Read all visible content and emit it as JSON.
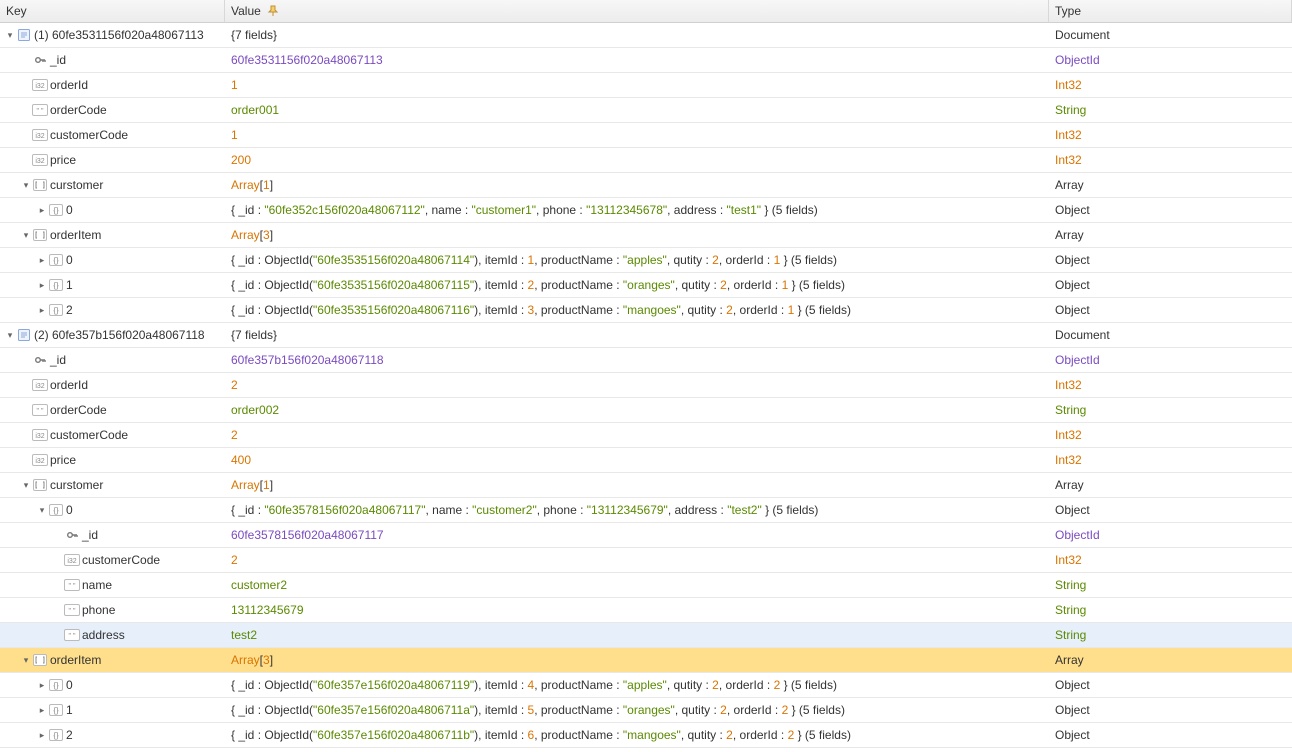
{
  "header": {
    "key": "Key",
    "value": "Value",
    "type": "Type"
  },
  "rows": [
    {
      "depth": 0,
      "tw": "down",
      "icon": "doc",
      "key": "(1) 60fe3531156f020a48067113",
      "value": [
        [
          "plain",
          "{7 fields}"
        ]
      ],
      "type": "Document",
      "typeColor": "plain"
    },
    {
      "depth": 1,
      "tw": "",
      "icon": "keyi",
      "key": "_id",
      "value": [
        [
          "oid",
          "60fe3531156f020a48067113"
        ]
      ],
      "type": "ObjectId",
      "typeColor": "oid"
    },
    {
      "depth": 1,
      "tw": "",
      "icon": "i32",
      "key": "orderId",
      "value": [
        [
          "num",
          "1"
        ]
      ],
      "type": "Int32",
      "typeColor": "num"
    },
    {
      "depth": 1,
      "tw": "",
      "icon": "strb",
      "key": "orderCode",
      "value": [
        [
          "str",
          "order001"
        ]
      ],
      "type": "String",
      "typeColor": "str"
    },
    {
      "depth": 1,
      "tw": "",
      "icon": "i32",
      "key": "customerCode",
      "value": [
        [
          "num",
          "1"
        ]
      ],
      "type": "Int32",
      "typeColor": "num"
    },
    {
      "depth": 1,
      "tw": "",
      "icon": "i32",
      "key": "price",
      "value": [
        [
          "num",
          "200"
        ]
      ],
      "type": "Int32",
      "typeColor": "num"
    },
    {
      "depth": 1,
      "tw": "down",
      "icon": "arr",
      "key": "curstomer",
      "value": [
        [
          "num",
          "Array"
        ],
        [
          "plain",
          "["
        ],
        [
          "num",
          "1"
        ],
        [
          "plain",
          "]"
        ]
      ],
      "type": "Array",
      "typeColor": "plain"
    },
    {
      "depth": 2,
      "tw": "right",
      "icon": "obj",
      "key": "0",
      "value": [
        [
          "plain",
          "{ _id : "
        ],
        [
          "str",
          "\"60fe352c156f020a48067112\""
        ],
        [
          "plain",
          ", name : "
        ],
        [
          "str",
          "\"customer1\""
        ],
        [
          "plain",
          ", phone : "
        ],
        [
          "str",
          "\"13112345678\""
        ],
        [
          "plain",
          ", address : "
        ],
        [
          "str",
          "\"test1\""
        ],
        [
          "plain",
          " } (5 fields)"
        ]
      ],
      "type": "Object",
      "typeColor": "plain"
    },
    {
      "depth": 1,
      "tw": "down",
      "icon": "arr",
      "key": "orderItem",
      "value": [
        [
          "num",
          "Array"
        ],
        [
          "plain",
          "["
        ],
        [
          "num",
          "3"
        ],
        [
          "plain",
          "]"
        ]
      ],
      "type": "Array",
      "typeColor": "plain"
    },
    {
      "depth": 2,
      "tw": "right",
      "icon": "obj",
      "key": "0",
      "value": [
        [
          "plain",
          "{ _id : ObjectId("
        ],
        [
          "str",
          "\"60fe3535156f020a48067114\""
        ],
        [
          "plain",
          "), itemId : "
        ],
        [
          "num",
          "1"
        ],
        [
          "plain",
          ", productName : "
        ],
        [
          "str",
          "\"apples\""
        ],
        [
          "plain",
          ", qutity : "
        ],
        [
          "num",
          "2"
        ],
        [
          "plain",
          ", orderId : "
        ],
        [
          "num",
          "1"
        ],
        [
          "plain",
          " } (5 fields)"
        ]
      ],
      "type": "Object",
      "typeColor": "plain"
    },
    {
      "depth": 2,
      "tw": "right",
      "icon": "obj",
      "key": "1",
      "value": [
        [
          "plain",
          "{ _id : ObjectId("
        ],
        [
          "str",
          "\"60fe3535156f020a48067115\""
        ],
        [
          "plain",
          "), itemId : "
        ],
        [
          "num",
          "2"
        ],
        [
          "plain",
          ", productName : "
        ],
        [
          "str",
          "\"oranges\""
        ],
        [
          "plain",
          ", qutity : "
        ],
        [
          "num",
          "2"
        ],
        [
          "plain",
          ", orderId : "
        ],
        [
          "num",
          "1"
        ],
        [
          "plain",
          " } (5 fields)"
        ]
      ],
      "type": "Object",
      "typeColor": "plain"
    },
    {
      "depth": 2,
      "tw": "right",
      "icon": "obj",
      "key": "2",
      "value": [
        [
          "plain",
          "{ _id : ObjectId("
        ],
        [
          "str",
          "\"60fe3535156f020a48067116\""
        ],
        [
          "plain",
          "), itemId : "
        ],
        [
          "num",
          "3"
        ],
        [
          "plain",
          ", productName : "
        ],
        [
          "str",
          "\"mangoes\""
        ],
        [
          "plain",
          ", qutity : "
        ],
        [
          "num",
          "2"
        ],
        [
          "plain",
          ", orderId : "
        ],
        [
          "num",
          "1"
        ],
        [
          "plain",
          " } (5 fields)"
        ]
      ],
      "type": "Object",
      "typeColor": "plain"
    },
    {
      "depth": 0,
      "tw": "down",
      "icon": "doc",
      "key": "(2) 60fe357b156f020a48067118",
      "value": [
        [
          "plain",
          "{7 fields}"
        ]
      ],
      "type": "Document",
      "typeColor": "plain"
    },
    {
      "depth": 1,
      "tw": "",
      "icon": "keyi",
      "key": "_id",
      "value": [
        [
          "oid",
          "60fe357b156f020a48067118"
        ]
      ],
      "type": "ObjectId",
      "typeColor": "oid"
    },
    {
      "depth": 1,
      "tw": "",
      "icon": "i32",
      "key": "orderId",
      "value": [
        [
          "num",
          "2"
        ]
      ],
      "type": "Int32",
      "typeColor": "num"
    },
    {
      "depth": 1,
      "tw": "",
      "icon": "strb",
      "key": "orderCode",
      "value": [
        [
          "str",
          "order002"
        ]
      ],
      "type": "String",
      "typeColor": "str"
    },
    {
      "depth": 1,
      "tw": "",
      "icon": "i32",
      "key": "customerCode",
      "value": [
        [
          "num",
          "2"
        ]
      ],
      "type": "Int32",
      "typeColor": "num"
    },
    {
      "depth": 1,
      "tw": "",
      "icon": "i32",
      "key": "price",
      "value": [
        [
          "num",
          "400"
        ]
      ],
      "type": "Int32",
      "typeColor": "num"
    },
    {
      "depth": 1,
      "tw": "down",
      "icon": "arr",
      "key": "curstomer",
      "value": [
        [
          "num",
          "Array"
        ],
        [
          "plain",
          "["
        ],
        [
          "num",
          "1"
        ],
        [
          "plain",
          "]"
        ]
      ],
      "type": "Array",
      "typeColor": "plain"
    },
    {
      "depth": 2,
      "tw": "down",
      "icon": "obj",
      "key": "0",
      "value": [
        [
          "plain",
          "{ _id : "
        ],
        [
          "str",
          "\"60fe3578156f020a48067117\""
        ],
        [
          "plain",
          ", name : "
        ],
        [
          "str",
          "\"customer2\""
        ],
        [
          "plain",
          ", phone : "
        ],
        [
          "str",
          "\"13112345679\""
        ],
        [
          "plain",
          ", address : "
        ],
        [
          "str",
          "\"test2\""
        ],
        [
          "plain",
          " } (5 fields)"
        ]
      ],
      "type": "Object",
      "typeColor": "plain"
    },
    {
      "depth": 3,
      "tw": "",
      "icon": "keyi",
      "key": "_id",
      "value": [
        [
          "oid",
          "60fe3578156f020a48067117"
        ]
      ],
      "type": "ObjectId",
      "typeColor": "oid"
    },
    {
      "depth": 3,
      "tw": "",
      "icon": "i32",
      "key": "customerCode",
      "value": [
        [
          "num",
          "2"
        ]
      ],
      "type": "Int32",
      "typeColor": "num"
    },
    {
      "depth": 3,
      "tw": "",
      "icon": "strb",
      "key": "name",
      "value": [
        [
          "str",
          "customer2"
        ]
      ],
      "type": "String",
      "typeColor": "str"
    },
    {
      "depth": 3,
      "tw": "",
      "icon": "strb",
      "key": "phone",
      "value": [
        [
          "str",
          "13112345679"
        ]
      ],
      "type": "String",
      "typeColor": "str"
    },
    {
      "depth": 3,
      "tw": "",
      "icon": "strb",
      "key": "address",
      "value": [
        [
          "str",
          "test2"
        ]
      ],
      "type": "String",
      "typeColor": "str",
      "sel": true
    },
    {
      "depth": 1,
      "tw": "down",
      "icon": "arr",
      "key": "orderItem",
      "value": [
        [
          "num",
          "Array"
        ],
        [
          "plain",
          "["
        ],
        [
          "num",
          "3"
        ],
        [
          "plain",
          "]"
        ]
      ],
      "type": "Array",
      "typeColor": "plain",
      "hl": true
    },
    {
      "depth": 2,
      "tw": "right",
      "icon": "obj",
      "key": "0",
      "value": [
        [
          "plain",
          "{ _id : ObjectId("
        ],
        [
          "str",
          "\"60fe357e156f020a48067119\""
        ],
        [
          "plain",
          "), itemId : "
        ],
        [
          "num",
          "4"
        ],
        [
          "plain",
          ", productName : "
        ],
        [
          "str",
          "\"apples\""
        ],
        [
          "plain",
          ", qutity : "
        ],
        [
          "num",
          "2"
        ],
        [
          "plain",
          ", orderId : "
        ],
        [
          "num",
          "2"
        ],
        [
          "plain",
          " } (5 fields)"
        ]
      ],
      "type": "Object",
      "typeColor": "plain"
    },
    {
      "depth": 2,
      "tw": "right",
      "icon": "obj",
      "key": "1",
      "value": [
        [
          "plain",
          "{ _id : ObjectId("
        ],
        [
          "str",
          "\"60fe357e156f020a4806711a\""
        ],
        [
          "plain",
          "), itemId : "
        ],
        [
          "num",
          "5"
        ],
        [
          "plain",
          ", productName : "
        ],
        [
          "str",
          "\"oranges\""
        ],
        [
          "plain",
          ", qutity : "
        ],
        [
          "num",
          "2"
        ],
        [
          "plain",
          ", orderId : "
        ],
        [
          "num",
          "2"
        ],
        [
          "plain",
          " } (5 fields)"
        ]
      ],
      "type": "Object",
      "typeColor": "plain"
    },
    {
      "depth": 2,
      "tw": "right",
      "icon": "obj",
      "key": "2",
      "value": [
        [
          "plain",
          "{ _id : ObjectId("
        ],
        [
          "str",
          "\"60fe357e156f020a4806711b\""
        ],
        [
          "plain",
          "), itemId : "
        ],
        [
          "num",
          "6"
        ],
        [
          "plain",
          ", productName : "
        ],
        [
          "str",
          "\"mangoes\""
        ],
        [
          "plain",
          ", qutity : "
        ],
        [
          "num",
          "2"
        ],
        [
          "plain",
          ", orderId : "
        ],
        [
          "num",
          "2"
        ],
        [
          "plain",
          " } (5 fields)"
        ]
      ],
      "type": "Object",
      "typeColor": "plain"
    }
  ]
}
